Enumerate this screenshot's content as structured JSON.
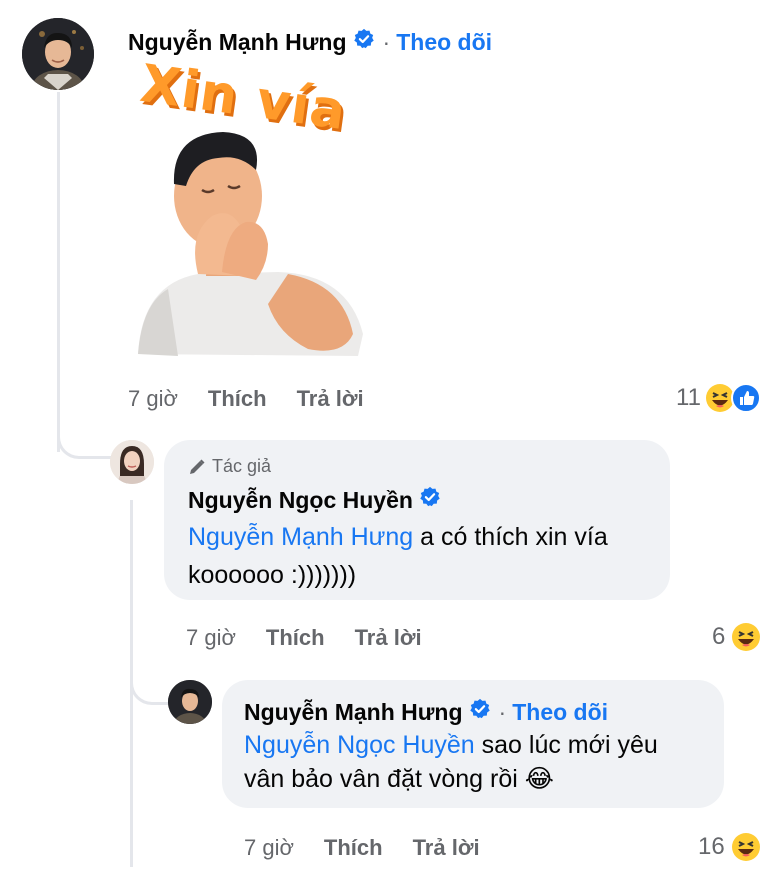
{
  "comments": [
    {
      "author": "Nguyễn Mạnh Hưng",
      "verified": true,
      "follow_label": "Theo dõi",
      "sticker": {
        "text": "Xin vía"
      },
      "time": "7 giờ",
      "like_label": "Thích",
      "reply_label": "Trả lời",
      "reaction_count": "11",
      "reactions": [
        "haha-icon",
        "like-icon"
      ]
    },
    {
      "badge": "Tác giả",
      "author": "Nguyễn Ngọc Huyền",
      "verified": true,
      "mention": "Nguyễn Mạnh Hưng",
      "text_line1": " a có thích xin vía",
      "text_line2": "koooooo :)))))))",
      "time": "7 giờ",
      "like_label": "Thích",
      "reply_label": "Trả lời",
      "reaction_count": "6",
      "reactions": [
        "haha-icon"
      ]
    },
    {
      "author": "Nguyễn Mạnh Hưng",
      "verified": true,
      "follow_label": "Theo dõi",
      "mention": "Nguyễn Ngọc Huyền",
      "text_line1": " sao lúc mới yêu",
      "text_line2": "vân bảo vân đặt vòng rồi",
      "text_emoji": "😂",
      "time": "7 giờ",
      "like_label": "Thích",
      "reply_label": "Trả lời",
      "reaction_count": "16",
      "reactions": [
        "haha-icon"
      ]
    }
  ],
  "colors": {
    "accent": "#1877f2",
    "bubble": "#f0f2f5",
    "meta": "#65676b",
    "sticker_text": "#ff9a2a"
  }
}
